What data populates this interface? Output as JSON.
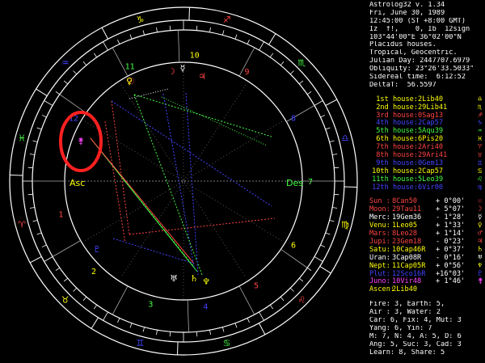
{
  "header": {
    "lines": [
      "Astrolog32 v. 1.34",
      "Fri, June 30, 1989",
      "12:45:00 (ST +8:00 GMT)",
      "Iz  f!,    0, Ib  12sign",
      "103°44'00\"E 36°02'00\"N",
      "Placidus houses.",
      "Tropical, Geocentric.",
      "Julian Day: 2447707.6979",
      "Obliquity: 23°26'33.5033\"",
      "Sidereal time:  6:12:52",
      "DeltaT:  56.5597"
    ]
  },
  "houses": [
    {
      "label": "1st house:",
      "value": "2Lib40",
      "color": "#ffff00",
      "glyph": "♎"
    },
    {
      "label": "2nd house:",
      "value": "29Lib41",
      "color": "#ffff00",
      "glyph": "♏"
    },
    {
      "label": "3rd house:",
      "value": "0Sag13",
      "color": "#ff4444",
      "glyph": "♐"
    },
    {
      "label": "4th house:",
      "value": "2Cap57",
      "color": "#4444ff",
      "glyph": "♑"
    },
    {
      "label": "5th house:",
      "value": "5Aqu39",
      "color": "#44ff44",
      "glyph": "♒"
    },
    {
      "label": "6th house:",
      "value": "6Pis20",
      "color": "#ffff00",
      "glyph": "♓"
    },
    {
      "label": "7th house:",
      "value": "2Ari40",
      "color": "#ff4444",
      "glyph": "♈"
    },
    {
      "label": "8th house:",
      "value": "29Ari41",
      "color": "#ff4444",
      "glyph": "♉"
    },
    {
      "label": "9th house:",
      "value": "0Gem13",
      "color": "#4444ff",
      "glyph": "♊"
    },
    {
      "label": "10th house:",
      "value": "2Cap57",
      "color": "#ffff00",
      "glyph": "♋"
    },
    {
      "label": "11th house:",
      "value": "5Leo39",
      "color": "#44ff44",
      "glyph": "♌"
    },
    {
      "label": "12th house:",
      "value": "6Vir00",
      "color": "#4444ff",
      "glyph": "♍"
    }
  ],
  "planets": [
    {
      "name": "Sun :",
      "pos": "8Can50",
      "speed": "+ 0°00'",
      "color": "#ff4444",
      "glyph": "☉"
    },
    {
      "name": "Moon:",
      "pos": "29Tau11",
      "speed": "+ 5°07'",
      "color": "#ff4444",
      "glyph": "☽"
    },
    {
      "name": "Merc:",
      "pos": "19Gem36",
      "speed": "- 1°28'",
      "color": "#ffffff",
      "glyph": "☿"
    },
    {
      "name": "Venu:",
      "pos": "1Leo05",
      "speed": "+ 1°33'",
      "color": "#ffff00",
      "glyph": "♀"
    },
    {
      "name": "Mars:",
      "pos": "8Leo28",
      "speed": "+ 1°14'",
      "color": "#ff4444",
      "glyph": "♂"
    },
    {
      "name": "Jupi:",
      "pos": "23Gem18",
      "speed": "- 0°23'",
      "color": "#ff4444",
      "glyph": "♃"
    },
    {
      "name": "Satu:",
      "pos": "10Cap46R",
      "speed": "+ 0°37'",
      "color": "#ffff00",
      "glyph": "♄"
    },
    {
      "name": "Uran:",
      "pos": "3Cap08R",
      "speed": "- 0°16'",
      "color": "#ffffff",
      "glyph": "♅"
    },
    {
      "name": "Nept:",
      "pos": "11Cap05R",
      "speed": "+ 0°56'",
      "color": "#ffff00",
      "glyph": "♆"
    },
    {
      "name": "Plut:",
      "pos": "12Sco16R",
      "speed": "+16°03'",
      "color": "#4444ff",
      "glyph": "♇"
    },
    {
      "name": "Juno:",
      "pos": "10Vir48",
      "speed": "+ 1°46'",
      "color": "#ff44ff",
      "glyph": "⚵"
    },
    {
      "name": "Ascen:",
      "pos": "2Lib40",
      "speed": "",
      "color": "#ffff00",
      "glyph": ""
    }
  ],
  "elements": [
    "Fire: 3, Earth: 5,",
    "Air : 3, Water: 2",
    "Car: 6, Fix: 4, Mut: 3",
    "Yang: 6, Yin: 7",
    "M: 7, N: 4, A: 5, D: 6",
    "Ang: 5, Suc: 3, Cad: 3",
    "Learn: 8, Share: 5"
  ],
  "wheel": {
    "asc_label": "Asc",
    "des_label": "Des",
    "sign_glyphs": [
      "♈",
      "♉",
      "♊",
      "♋",
      "♌",
      "♍",
      "♎",
      "♏",
      "♐",
      "♑",
      "♒",
      "♓"
    ],
    "house_numbers": [
      "1",
      "2",
      "3",
      "4",
      "5",
      "6",
      "7",
      "8",
      "9",
      "10",
      "11",
      "12"
    ]
  }
}
